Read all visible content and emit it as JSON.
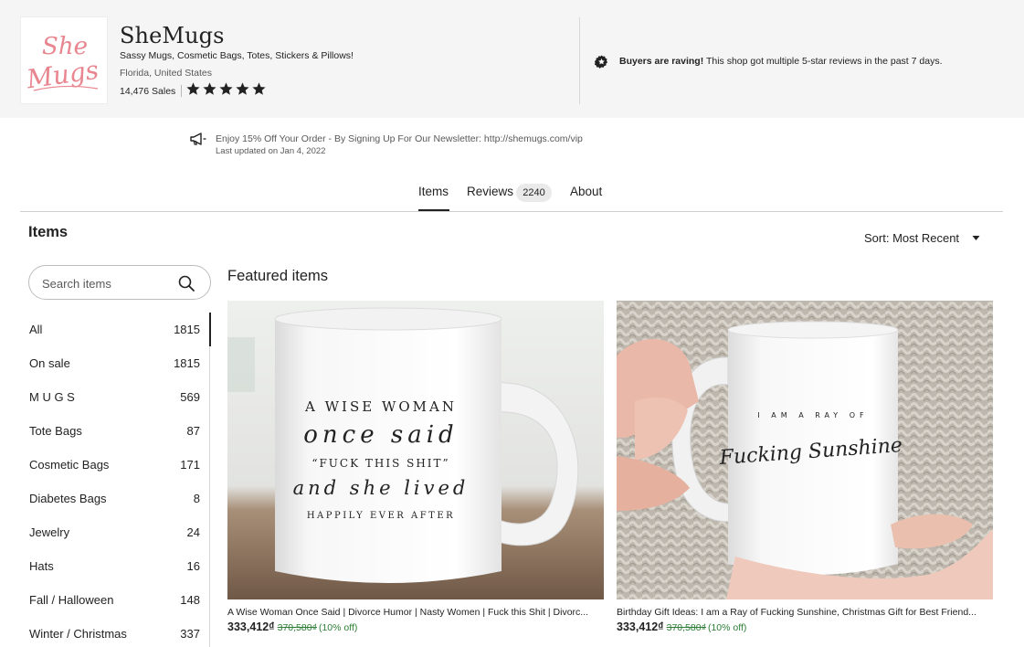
{
  "shop": {
    "logo_text_1": "She",
    "logo_text_2": "Mugs",
    "name": "SheMugs",
    "tagline": "Sassy Mugs, Cosmetic Bags, Totes, Stickers & Pillows!",
    "location": "Florida, United States",
    "sales": "14,476 Sales",
    "rating_stars": 5,
    "logo_color": "#e8858f"
  },
  "highlight": {
    "icon": "star-badge-icon",
    "bold": "Buyers are raving!",
    "text": " This shop got multiple 5-star reviews in the past 7 days."
  },
  "announcement": {
    "icon": "megaphone-icon",
    "text": "Enjoy 15% Off Your Order - By Signing Up For Our Newsletter: http://shemugs.com/vip",
    "updated": "Last updated on Jan 4, 2022"
  },
  "tabs": {
    "items_label": "Items",
    "reviews_label": "Reviews",
    "reviews_count": "2240",
    "about_label": "About"
  },
  "sidebar": {
    "heading": "Items",
    "search_placeholder": "Search items",
    "sections": [
      {
        "label": "All",
        "count": "1815"
      },
      {
        "label": "On sale",
        "count": "1815"
      },
      {
        "label": "M U G S",
        "count": "569"
      },
      {
        "label": "Tote Bags",
        "count": "87"
      },
      {
        "label": "Cosmetic Bags",
        "count": "171"
      },
      {
        "label": "Diabetes Bags",
        "count": "8"
      },
      {
        "label": "Jewelry",
        "count": "24"
      },
      {
        "label": "Hats",
        "count": "16"
      },
      {
        "label": "Fall / Halloween",
        "count": "148"
      },
      {
        "label": "Winter / Christmas",
        "count": "337"
      }
    ]
  },
  "sort": {
    "label": "Sort: Most Recent"
  },
  "featured": {
    "heading": "Featured items",
    "items": [
      {
        "image_text": [
          "A WISE WOMAN",
          "once said",
          "“FUCK THIS SHIT”",
          "and she lived",
          "HAPPILY EVER AFTER"
        ],
        "title": "A Wise Woman Once Said | Divorce Humor | Nasty Women | Fuck this Shit | Divorc...",
        "price": "333,412₫",
        "original_price": "370,580₫",
        "discount": "(10% off)"
      },
      {
        "image_text": [
          "I AM A RAY OF",
          "Fucking Sunshine"
        ],
        "title": "Birthday Gift Ideas: I am a Ray of Fucking Sunshine, Christmas Gift for Best Friend...",
        "price": "333,412₫",
        "original_price": "370,580₫",
        "discount": "(10% off)"
      }
    ]
  },
  "colors": {
    "header_bg": "#f5f5f5",
    "sale_green": "#2c7f35",
    "text": "#222222"
  }
}
